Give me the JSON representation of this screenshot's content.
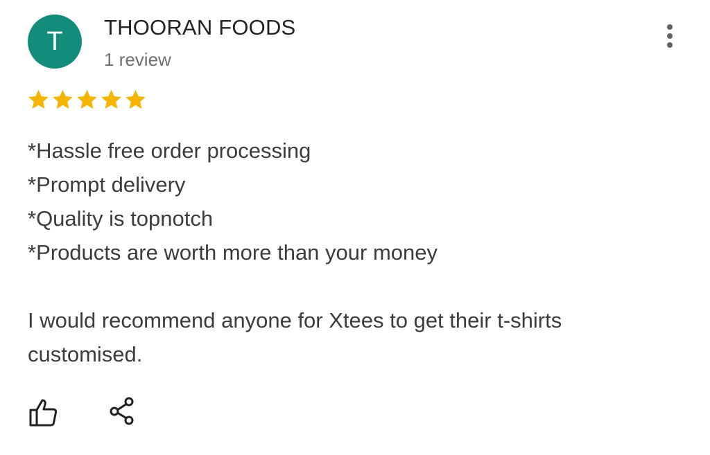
{
  "reviewer": {
    "avatar_initial": "T",
    "avatar_color": "#138c7c",
    "name": "THOORAN FOODS",
    "review_count": "1 review"
  },
  "rating": {
    "stars": 5,
    "max_stars": 5,
    "star_color": "#f4b400"
  },
  "review": {
    "lines": [
      "*Hassle free order processing",
      "*Prompt delivery",
      "*Quality is topnotch",
      "*Products are worth more than your money"
    ],
    "paragraph": "I would recommend anyone for Xtees to get their t-shirts customised."
  },
  "actions": {
    "like_icon": "thumbs-up-icon",
    "share_icon": "share-icon",
    "more_icon": "more-vert-icon"
  }
}
